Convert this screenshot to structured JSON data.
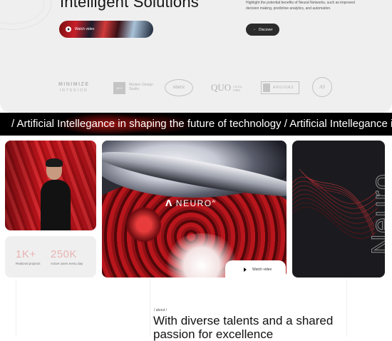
{
  "hero": {
    "title": "Intelligent Solutions",
    "description": "Highlight the potential benefits of Neural Networks, such as improved decision making, predictive analytics, and automation.",
    "watch_label": "Watch video",
    "discover_label": "Discover",
    "discover_arrow": "→"
  },
  "logos": {
    "minimize": {
      "line1": "MINIMIZE",
      "line2": "INTERIOR"
    },
    "modern": {
      "badge": "MDS",
      "text": "Modern Design Studio"
    },
    "matrix": "Matrix",
    "quo": {
      "main": "QUO",
      "sub1": "LEGAL",
      "sub2": "FIRM"
    },
    "arginas": "ARGINAS",
    "monogram": "AS"
  },
  "marquee": {
    "text": "/ Artificial Intellegance in shaping the future of technology / Artificial Intellegance in shaping the future of technology"
  },
  "stats": [
    {
      "value": "1K+",
      "label": "Realized projects"
    },
    {
      "value": "250K",
      "label": "Active users every day"
    }
  ],
  "brand": {
    "mark": "ᐱ",
    "name": "NEURO",
    "sup": "AI"
  },
  "video": {
    "label": "Watch video",
    "play_icon": "play-icon"
  },
  "side_card": {
    "word": "Neuro"
  },
  "about": {
    "tag": "/ about /",
    "heading": "With diverse talents and a shared passion for excellence"
  }
}
